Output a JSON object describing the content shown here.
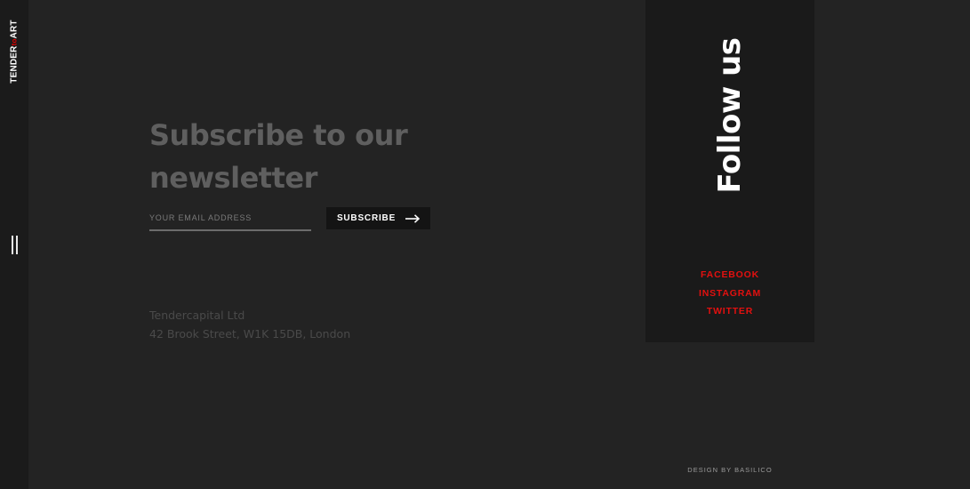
{
  "brand": {
    "logo_part1": "TENDER",
    "logo_part2": "to",
    "logo_part3": "ART",
    "accent_color": "#e00000"
  },
  "nav": {
    "menu_icon": "menu-toggle-icon"
  },
  "newsletter": {
    "title": "Subscribe to our newsletter",
    "email_placeholder": "YOUR EMAIL ADDRESS",
    "subscribe_label": "SUBSCRIBE",
    "subscribe_icon": "arrow-right-icon"
  },
  "address": {
    "company": "Tendercapital Ltd",
    "street": "42 Brook Street, W1K 15DB, London"
  },
  "follow": {
    "title": "Follow us",
    "links": [
      {
        "label": "FACEBOOK"
      },
      {
        "label": "INSTAGRAM"
      },
      {
        "label": "TWITTER"
      }
    ]
  },
  "footer": {
    "credit": "DESIGN BY BASILICO"
  }
}
